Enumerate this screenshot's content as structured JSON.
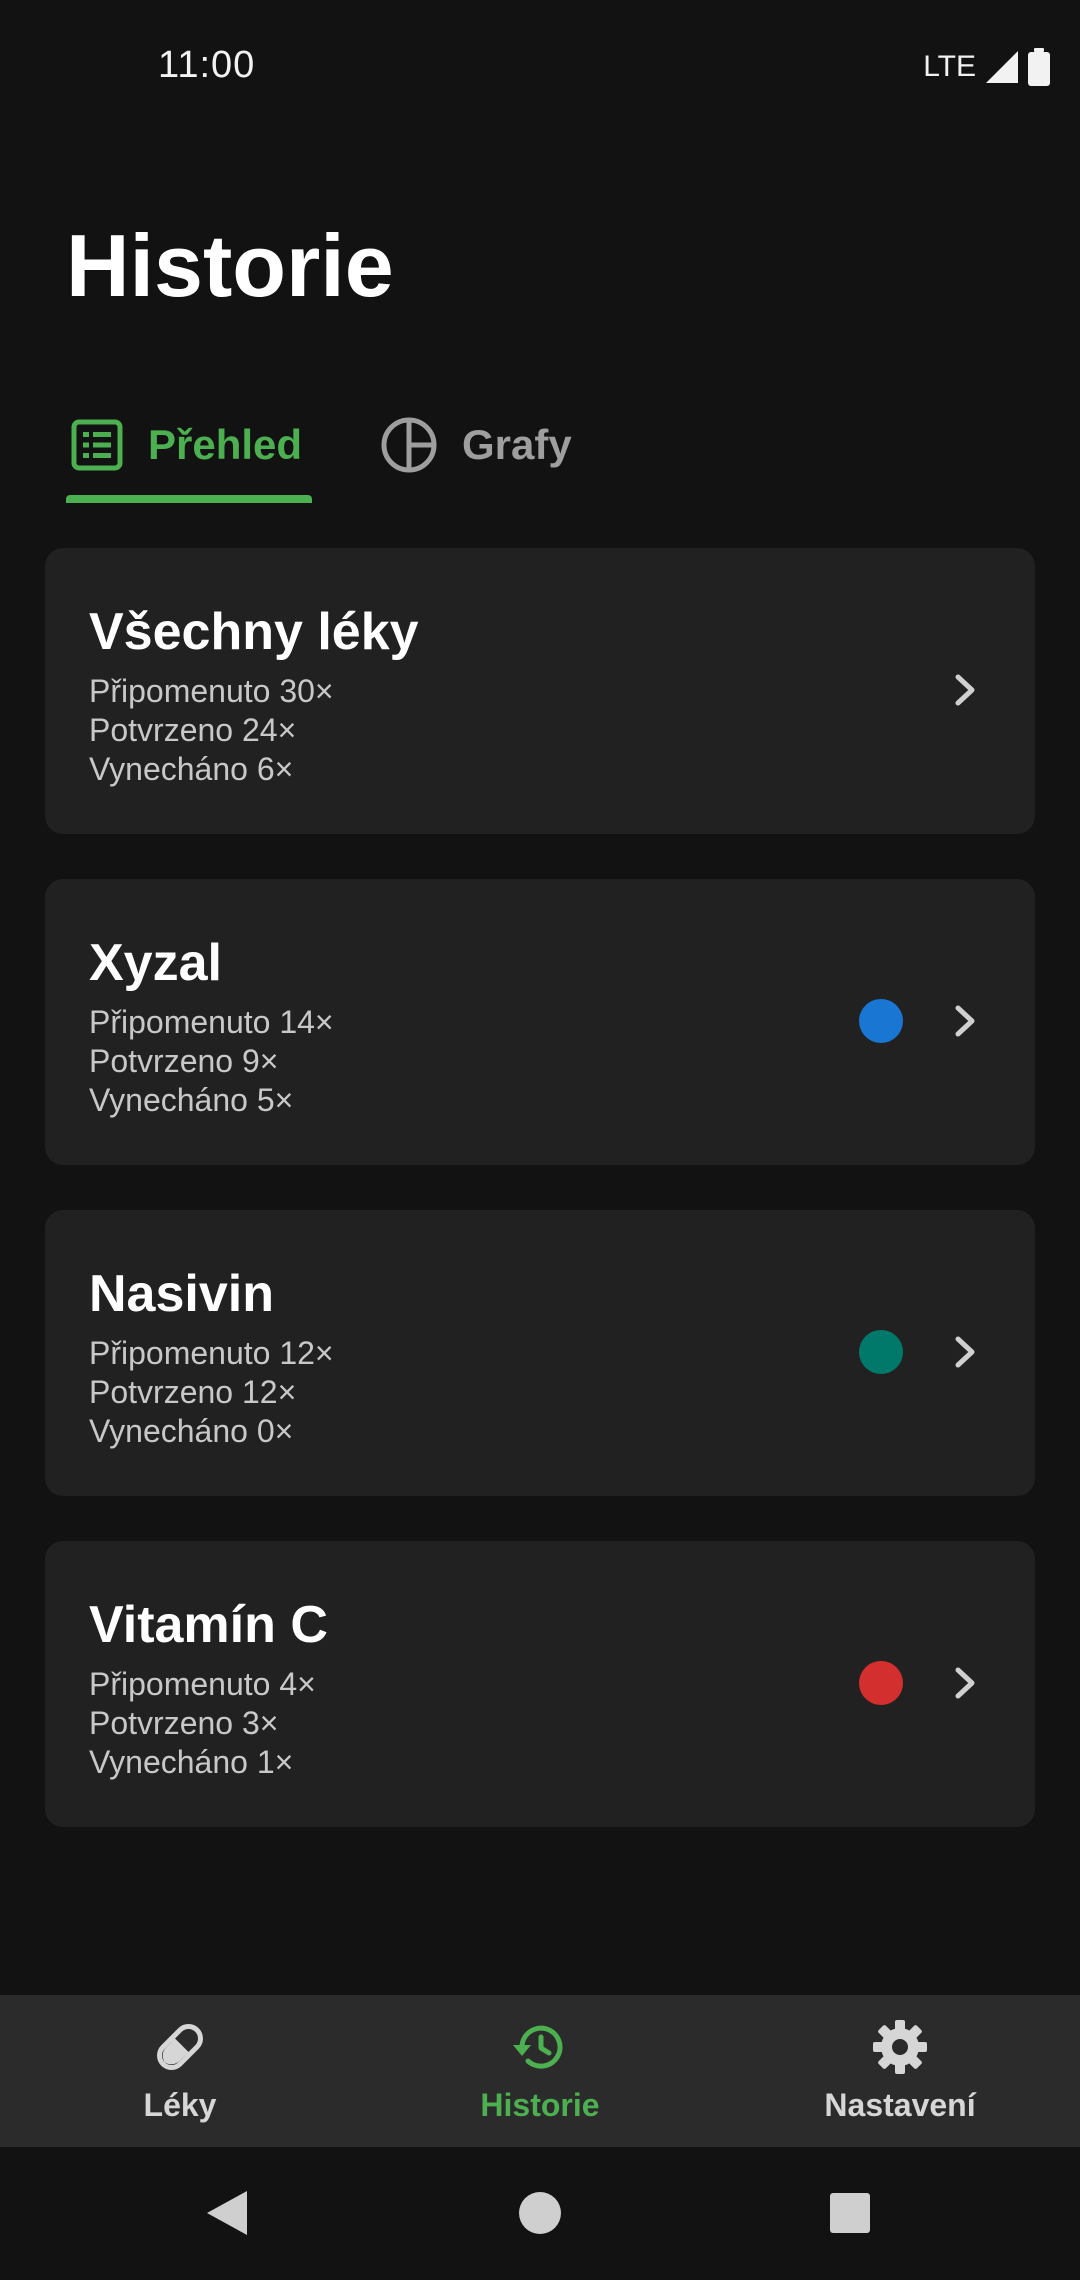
{
  "status_bar": {
    "time": "11:00",
    "network": "LTE"
  },
  "page": {
    "title": "Historie"
  },
  "tabs": [
    {
      "label": "Přehled",
      "icon": "list-icon",
      "active": true
    },
    {
      "label": "Grafy",
      "icon": "pie-chart-icon",
      "active": false
    }
  ],
  "colors": {
    "accent": "#4caf50",
    "background": "#121212",
    "card": "#212121"
  },
  "cards": [
    {
      "name": "Všechny léky",
      "reminded": "Připomenuto 30×",
      "confirmed": "Potvrzeno 24×",
      "skipped": "Vynecháno 6×",
      "color": null
    },
    {
      "name": "Xyzal",
      "reminded": "Připomenuto 14×",
      "confirmed": "Potvrzeno 9×",
      "skipped": "Vynecháno 5×",
      "color": "#1976d2"
    },
    {
      "name": "Nasivin",
      "reminded": "Připomenuto 12×",
      "confirmed": "Potvrzeno 12×",
      "skipped": "Vynecháno 0×",
      "color": "#00796b"
    },
    {
      "name": "Vitamín C",
      "reminded": "Připomenuto 4×",
      "confirmed": "Potvrzeno 3×",
      "skipped": "Vynecháno 1×",
      "color": "#d32f2f"
    }
  ],
  "bottom_nav": [
    {
      "label": "Léky",
      "icon": "pill-icon",
      "active": false
    },
    {
      "label": "Historie",
      "icon": "history-icon",
      "active": true
    },
    {
      "label": "Nastavení",
      "icon": "gear-icon",
      "active": false
    }
  ]
}
